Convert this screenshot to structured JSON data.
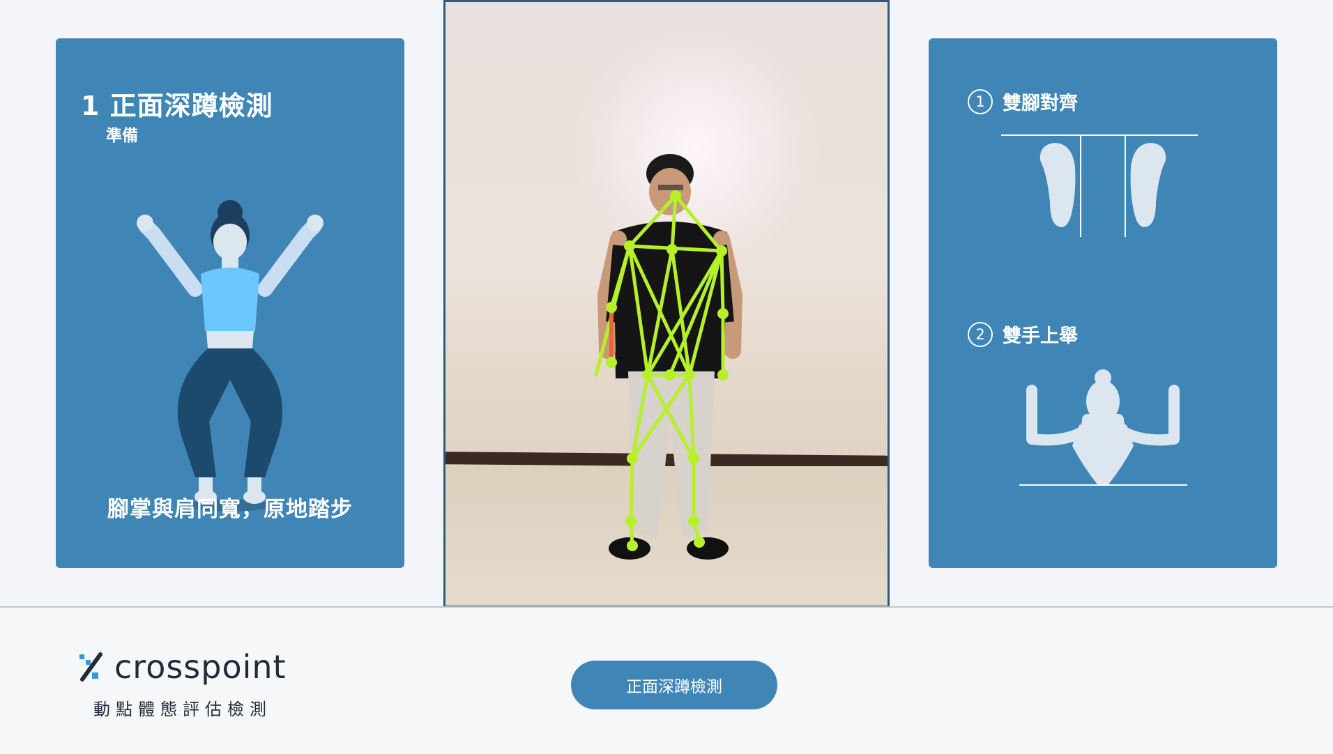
{
  "left_panel": {
    "step_title": "1 正面深蹲檢測",
    "step_status": "準備",
    "instruction": "腳掌與肩同寬，原地踏步"
  },
  "right_panel": {
    "requirements": [
      {
        "number": "1",
        "label": "雙腳對齊"
      },
      {
        "number": "2",
        "label": "雙手上舉"
      }
    ]
  },
  "camera": {
    "skeleton_color": "#b6f02a",
    "highlight_color": "#e8663a"
  },
  "brand": {
    "name": "crosspoint",
    "subtitle": "動點體態評估檢測"
  },
  "action_button": {
    "label": "正面深蹲檢測"
  },
  "colors": {
    "panel": "#3f86b6",
    "figure_light": "#dbe6ef",
    "figure_dark": "#1c4a6c",
    "accent": "#6cc6ff"
  }
}
